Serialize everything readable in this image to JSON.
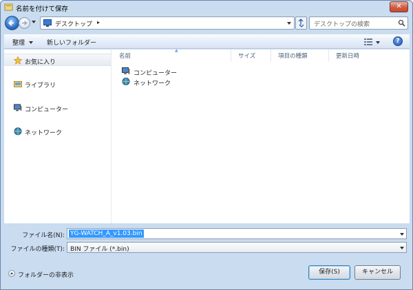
{
  "window": {
    "title": "名前を付けて保存",
    "close": "✕"
  },
  "address": {
    "path": "デスクトップ",
    "chevron": "▸"
  },
  "search": {
    "placeholder": "デスクトップの検索"
  },
  "toolbar": {
    "organize": "整理",
    "new_folder": "新しいフォルダー",
    "help": "?"
  },
  "sidebar": {
    "items": [
      {
        "label": "お気に入り",
        "icon": "star-icon"
      },
      {
        "label": "ライブラリ",
        "icon": "library-icon"
      },
      {
        "label": "コンピューター",
        "icon": "computer-icon"
      },
      {
        "label": "ネットワーク",
        "icon": "network-icon"
      }
    ]
  },
  "columns": {
    "name": "名前",
    "size": "サイズ",
    "type": "項目の種類",
    "modified": "更新日時"
  },
  "files": [
    {
      "label": "コンピューター",
      "icon": "computer-icon"
    },
    {
      "label": "ネットワーク",
      "icon": "network-icon"
    }
  ],
  "form": {
    "filename_label": "ファイル名(N):",
    "filename_value": "YG-WATCH_A_v1.03.bin",
    "filetype_label": "ファイルの種類(T):",
    "filetype_value": "BIN ファイル (*.bin)"
  },
  "bottom": {
    "hide_folders": "フォルダーの非表示",
    "save": "保存(S)",
    "cancel": "キャンセル"
  },
  "colors": {
    "frame": "#c9dcf0",
    "selection": "#3399ff",
    "close_button": "#c54a30"
  }
}
